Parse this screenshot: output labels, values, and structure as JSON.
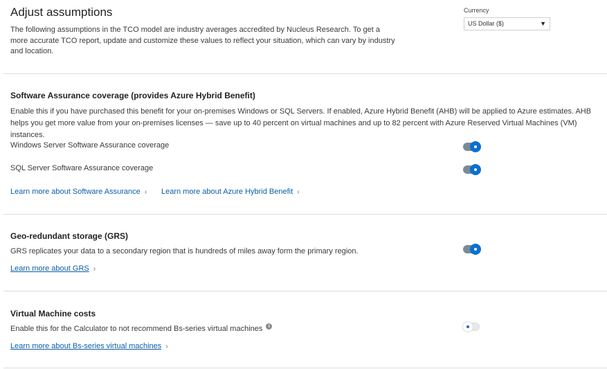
{
  "header": {
    "title": "Adjust assumptions",
    "intro": "The following assumptions in the TCO model are industry averages accredited by Nucleus Research. To get a more accurate TCO report, update and customize these values to reflect your situation, which can vary by industry and location."
  },
  "currency": {
    "label": "Currency",
    "selected": "US Dollar ($)"
  },
  "software_assurance": {
    "title": "Software Assurance coverage (provides Azure Hybrid Benefit)",
    "description": "Enable this if you have purchased this benefit for your on-premises Windows or SQL Servers. If enabled, Azure Hybrid Benefit (AHB) will be applied to Azure estimates. AHB helps you get more value from your on-premises licenses — save up to 40 percent on virtual machines and up to 82 percent with Azure Reserved Virtual Machines (VM) instances.",
    "windows_label": "Windows Server Software Assurance coverage",
    "windows_enabled": true,
    "sql_label": "SQL Server Software Assurance coverage",
    "sql_enabled": true,
    "link_sa": "Learn more about Software Assurance",
    "link_ahb": "Learn more about Azure Hybrid Benefit"
  },
  "grs": {
    "title": "Geo-redundant storage (GRS)",
    "description": "GRS replicates your data to a secondary region that is hundreds of miles away form the primary region.",
    "enabled": true,
    "link": "Learn more about GRS"
  },
  "vm_costs": {
    "title": "Virtual Machine costs",
    "description": "Enable this for the Calculator to not recommend Bs-series virtual machines",
    "enabled": false,
    "link": "Learn more about Bs-series virtual machines"
  },
  "icons": {
    "caret": "caret-down-icon",
    "chevron": "chevron-right-icon",
    "info": "info-icon"
  },
  "colors": {
    "accent": "#0a70cf",
    "link": "#0b5ea8"
  }
}
